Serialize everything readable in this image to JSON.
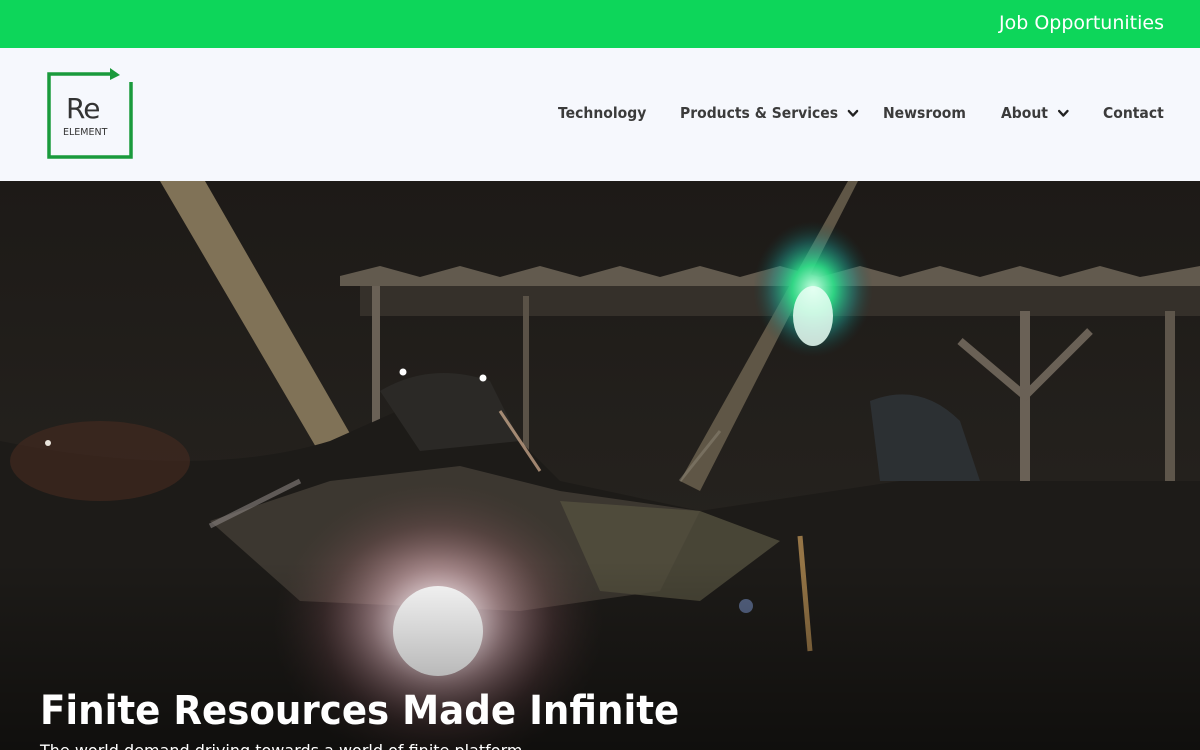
{
  "topbar": {
    "job_link": "Job Opportunities",
    "color": "#0dd65a"
  },
  "logo": {
    "line1": "Re",
    "line2": "ELEMENT",
    "color": "#1a9a3c"
  },
  "nav": {
    "items": [
      {
        "label": "Technology",
        "has_dropdown": false
      },
      {
        "label": "Products & Services",
        "has_dropdown": true
      },
      {
        "label": "Newsroom",
        "has_dropdown": false
      },
      {
        "label": "About",
        "has_dropdown": true
      },
      {
        "label": "Contact",
        "has_dropdown": false
      }
    ],
    "dropdown_icon": "chevron-down-icon"
  },
  "hero": {
    "title": "Finite Resources Made Infinite",
    "subtitle": "The world demand driving towards a world of finite platform"
  }
}
